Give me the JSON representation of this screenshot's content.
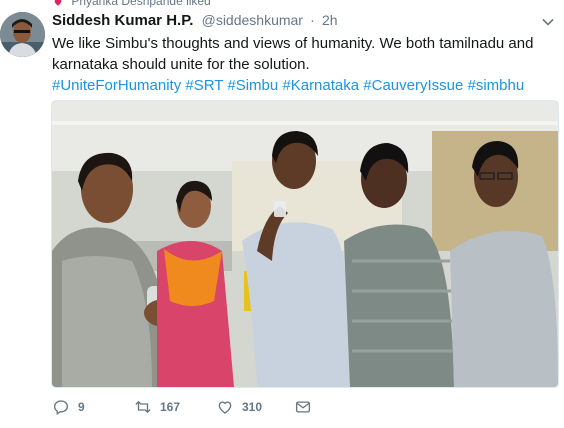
{
  "context": {
    "text": "Priyanka Deshpande liked",
    "icon": "heart-icon"
  },
  "tweet": {
    "author_name": "Siddesh Kumar H.P.",
    "handle": "@siddeshkumar",
    "separator": "·",
    "time": "2h",
    "text_line1": "We like Simbu's thoughts and views of humanity. We both tamilnadu and",
    "text_line2": "karnataka should unite for the solution.",
    "hashtags": "#UniteForHumanity #SRT #Simbu #Karnataka #CauveryIssue #simbhu"
  },
  "actions": {
    "reply_count": "9",
    "retweet_count": "167",
    "like_count": "310"
  },
  "icons": {
    "reply": "reply-icon",
    "retweet": "retweet-icon",
    "like": "like-icon",
    "message": "direct-message-icon",
    "menu": "chevron-down-icon"
  },
  "colors": {
    "link": "#1b95e0",
    "muted": "#657786",
    "text": "#14171a"
  }
}
